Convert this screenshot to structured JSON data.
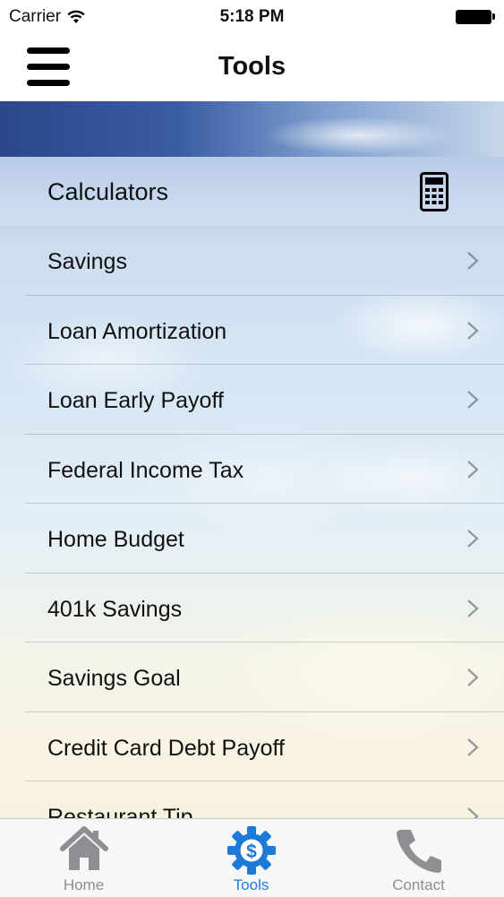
{
  "status_bar": {
    "carrier": "Carrier",
    "time": "5:18 PM"
  },
  "nav": {
    "title": "Tools"
  },
  "section": {
    "title": "Calculators",
    "icon": "calculator-icon"
  },
  "items": [
    {
      "label": "Savings"
    },
    {
      "label": "Loan Amortization"
    },
    {
      "label": "Loan Early Payoff"
    },
    {
      "label": "Federal Income Tax"
    },
    {
      "label": "Home Budget"
    },
    {
      "label": "401k Savings"
    },
    {
      "label": "Savings Goal"
    },
    {
      "label": "Credit Card Debt Payoff"
    },
    {
      "label": "Restaurant Tip"
    }
  ],
  "tabs": [
    {
      "label": "Home",
      "icon": "house-icon",
      "active": false
    },
    {
      "label": "Tools",
      "icon": "gear-dollar-icon",
      "active": true
    },
    {
      "label": "Contact",
      "icon": "phone-icon",
      "active": false
    }
  ],
  "colors": {
    "accent": "#1e7ad8",
    "inactive": "#8e8e93"
  }
}
